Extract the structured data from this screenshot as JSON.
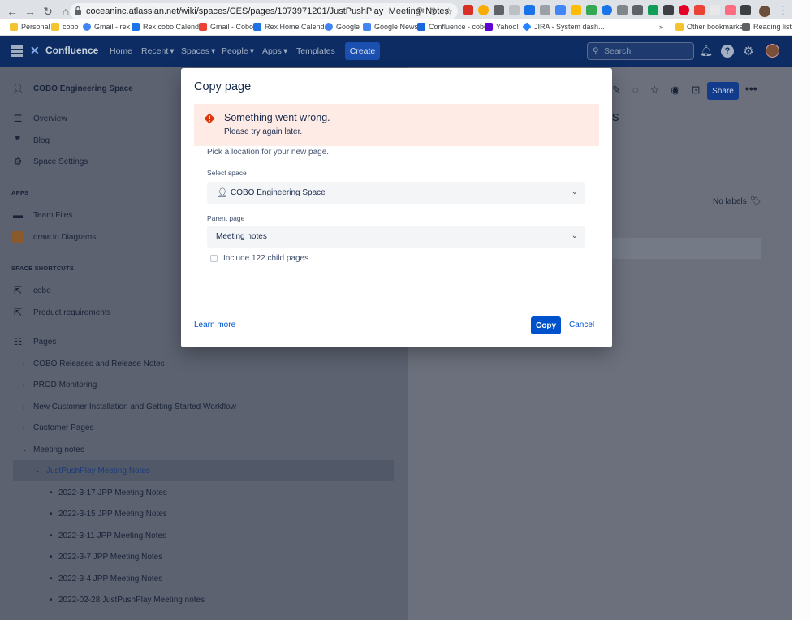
{
  "browser": {
    "url": "coceaninc.atlassian.net/wiki/spaces/CES/pages/1073971201/JustPushPlay+Meeting+Notes",
    "bookmarks": [
      {
        "label": "Personal",
        "color": "#f4c430"
      },
      {
        "label": "cobo",
        "color": "#f4c430"
      },
      {
        "label": "Gmail - rex",
        "color": "#4285f4"
      },
      {
        "label": "Rex cobo Calendar",
        "color": "#1a73e8"
      },
      {
        "label": "Gmail - Cobo",
        "color": "#ea4335"
      },
      {
        "label": "Rex Home Calendar",
        "color": "#1a73e8"
      },
      {
        "label": "Google",
        "color": "#4285f4"
      },
      {
        "label": "Google News",
        "color": "#4285f4"
      },
      {
        "label": "Confluence - cobo",
        "color": "#1868db"
      },
      {
        "label": "Yahoo!",
        "color": "#6001d2"
      },
      {
        "label": "JIRA - System dash...",
        "color": "#2684ff"
      },
      {
        "label": "Other bookmarks",
        "color": "#f4c430"
      },
      {
        "label": "Reading list",
        "color": "#5f6368"
      }
    ],
    "more_bookmarks": "»"
  },
  "header": {
    "logo_text": "Confluence",
    "nav": [
      "Home",
      "Recent",
      "Spaces",
      "People",
      "Apps",
      "Templates"
    ],
    "create_label": "Create",
    "search_placeholder": "Search"
  },
  "sidebar": {
    "space_name": "COBO Engineering Space",
    "items": [
      "Overview",
      "Blog",
      "Space Settings"
    ],
    "apps_heading": "APPS",
    "apps": [
      "Team Files",
      "draw.io Diagrams"
    ],
    "shortcuts_heading": "SPACE SHORTCUTS",
    "shortcuts": [
      "cobo",
      "Product requirements"
    ],
    "pages_label": "Pages",
    "tree": [
      "COBO Releases and Release Notes",
      "PROD Monitoring",
      "New Customer Installation and Getting Started Workflow",
      "Customer Pages",
      "Meeting notes"
    ],
    "selected": "JustPushPlay Meeting Notes",
    "children": [
      "2022-3-17 JPP Meeting Notes",
      "2022-3-15 JPP Meeting Notes",
      "2022-3-11 JPP Meeting Notes",
      "2022-3-7 JPP Meeting Notes",
      "2022-3-4 JPP Meeting Notes",
      "2022-02-28 JustPushPlay Meeting notes"
    ]
  },
  "main": {
    "share_label": "Share",
    "title_fragment": "s",
    "no_labels": "No labels"
  },
  "dialog": {
    "title": "Copy page",
    "error_title": "Something went wrong.",
    "error_sub": "Please try again later.",
    "pick_text": "Pick a location for your new page.",
    "space_label": "Select space",
    "space_value": "COBO Engineering Space",
    "parent_label": "Parent page",
    "parent_value": "Meeting notes",
    "include_label": "Include 122 child pages",
    "learn_more": "Learn more",
    "copy_label": "Copy",
    "cancel_label": "Cancel"
  }
}
